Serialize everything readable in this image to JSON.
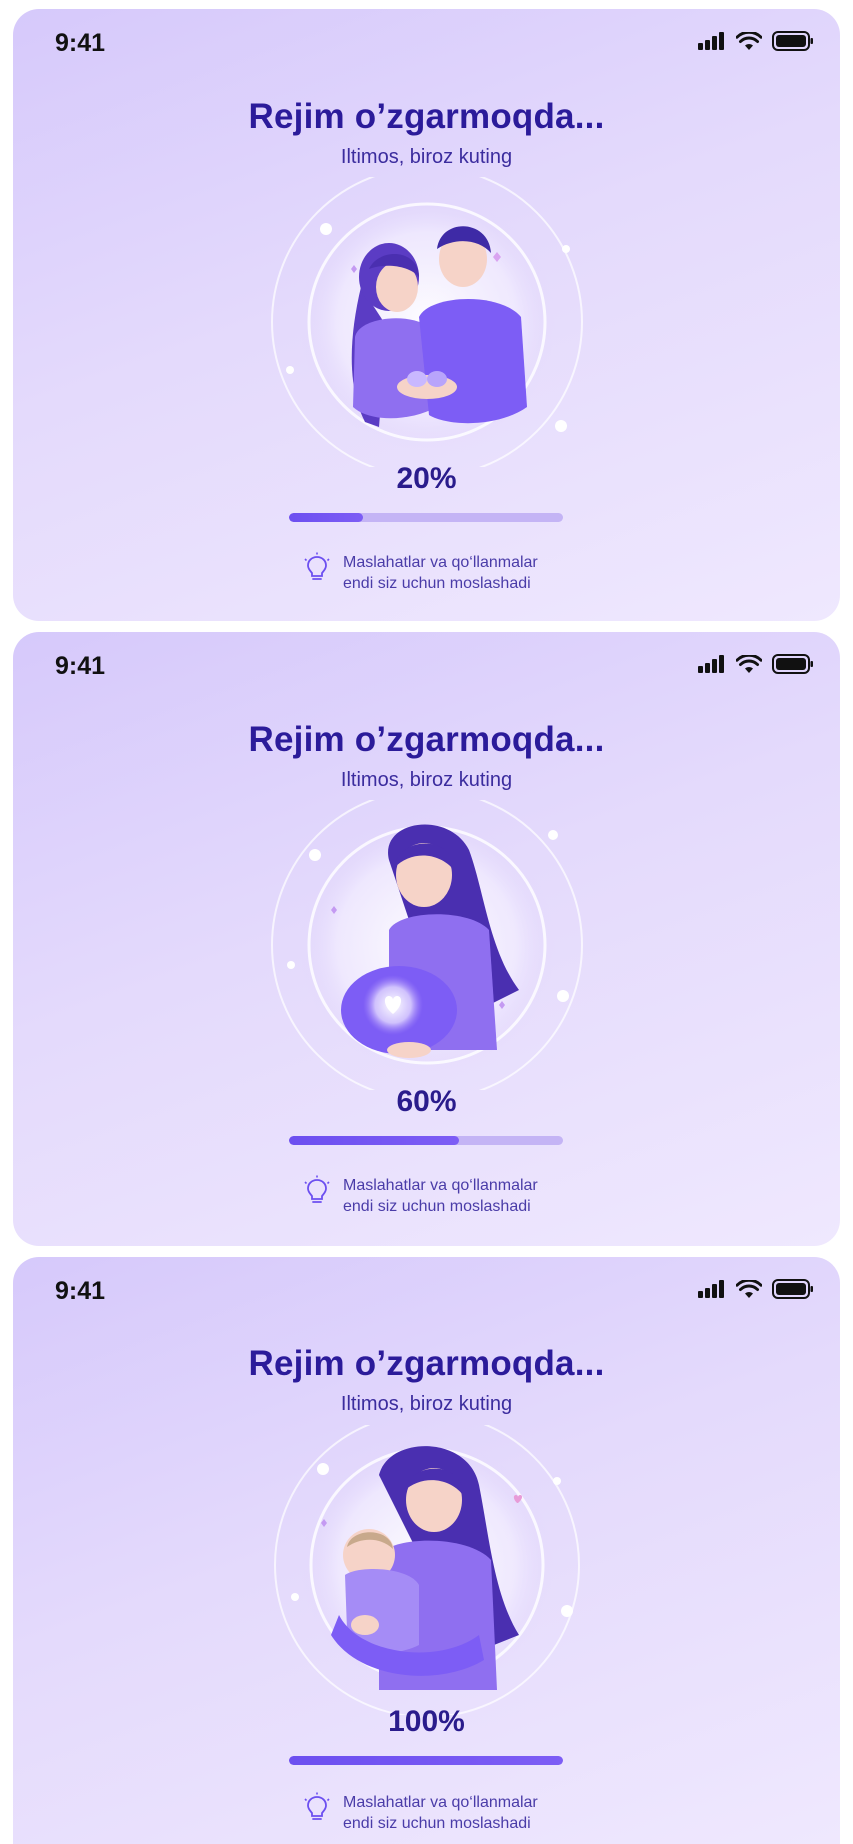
{
  "screens": [
    {
      "status_time": "9:41",
      "title": "Rejim o’zgarmoqda...",
      "subtitle": "Iltimos, biroz kuting",
      "illustration": "couple-holding-baby-shoes",
      "progress_label": "20%",
      "progress_value": 0.27,
      "tip_icon": "lightbulb-icon",
      "tip_line1": "Maslahatlar va qo‘llanmalar",
      "tip_line2": "endi siz uchun moslashadi"
    },
    {
      "status_time": "9:41",
      "title": "Rejim o’zgarmoqda...",
      "subtitle": "Iltimos, biroz kuting",
      "illustration": "pregnant-woman-glowing-heart",
      "progress_label": "60%",
      "progress_value": 0.62,
      "tip_icon": "lightbulb-icon",
      "tip_line1": "Maslahatlar va qo‘llanmalar",
      "tip_line2": "endi siz uchun moslashadi"
    },
    {
      "status_time": "9:41",
      "title": "Rejim o’zgarmoqda...",
      "subtitle": "Iltimos, biroz kuting",
      "illustration": "mother-holding-baby",
      "progress_label": "100%",
      "progress_value": 1.0,
      "tip_icon": "lightbulb-icon",
      "tip_line1": "Maslahatlar va qo‘llanmalar",
      "tip_line2": "endi siz uchun moslashadi"
    }
  ],
  "colors": {
    "accent": "#6c4ff0",
    "title": "#2b1b9a",
    "track": "#c4b4f5",
    "background": "#e4dafc"
  }
}
